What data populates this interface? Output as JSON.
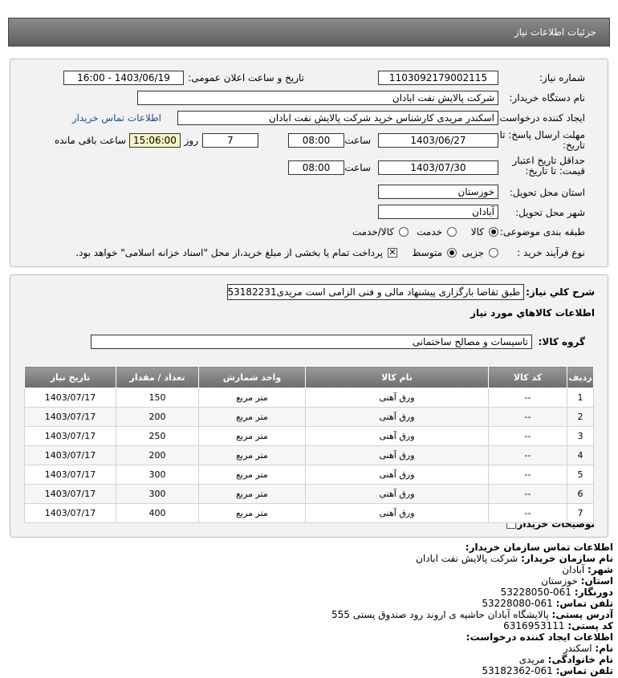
{
  "header": {
    "title": "جزئیات اطلاعات نیاز"
  },
  "fields": {
    "need_number_label": "شماره نیاز:",
    "need_number": "1103092179002115",
    "announce_label": "تاریخ و ساعت اعلان عمومی:",
    "announce_value": "1403/06/19 - 16:00",
    "buyer_org_label": "نام دستگاه خریدار:",
    "buyer_org": "شرکت پالایش نفت ابادان",
    "creator_label": "ایجاد کننده درخواست:",
    "creator": "اسکندر مریدی کارشناس خرید شرکت پالایش نفت ابادان",
    "contact_link": "اطلاعات تماس خریدار",
    "deadline_label": "مهلت ارسال پاسخ: تا تاریخ:",
    "deadline_date": "1403/06/27",
    "time_label": "ساعت",
    "deadline_time": "08:00",
    "days_value": "7",
    "days_label": "روز و",
    "remaining_time": "15:06:00",
    "remaining_label": "ساعت باقی مانده",
    "validity_label": "حداقل تاریخ اعتبار قیمت: تا تاریخ:",
    "validity_date": "1403/07/30",
    "validity_time": "08:00",
    "province_label": "استان محل تحویل:",
    "province": "خوزستان",
    "city_label": "شهر محل تحویل:",
    "city": "آبادان",
    "category_label": "طبقه بندی موضوعی:",
    "category_options": [
      "کالا",
      "خدمت",
      "کالا/خدمت"
    ],
    "process_label": "نوع فرآیند خرید :",
    "process_options": [
      "جزیی",
      "متوسط"
    ],
    "payment_note": "پرداخت تمام یا بخشی از مبلغ خرید،از محل \"اسناد خزانه اسلامی\" خواهد بود."
  },
  "summary": {
    "desc_label": "شرح کلي نياز:",
    "desc_value": "طبق تقاضا بارگزاری پیشنهاد مالی و فنی الزامی است مریدی53182231",
    "goods_title": "اطلاعات کالاهاي مورد نياز",
    "group_label": "گروه کالا:",
    "group_value": "تاسیسات و مصالح ساختمانی"
  },
  "table": {
    "headers": [
      "ردیف",
      "کد کالا",
      "نام کالا",
      "واحد شمارش",
      "تعداد / مقدار",
      "تاریخ نیاز"
    ],
    "rows": [
      [
        "1",
        "--",
        "ورق آهنی",
        "متر مربع",
        "150",
        "1403/07/17"
      ],
      [
        "2",
        "--",
        "ورق آهنی",
        "متر مربع",
        "200",
        "1403/07/17"
      ],
      [
        "3",
        "--",
        "ورق آهنی",
        "متر مربع",
        "250",
        "1403/07/17"
      ],
      [
        "4",
        "--",
        "ورق آهنی",
        "متر مربع",
        "200",
        "1403/07/17"
      ],
      [
        "5",
        "--",
        "ورق آهنی",
        "متر مربع",
        "300",
        "1403/07/17"
      ],
      [
        "6",
        "--",
        "ورق آهنی",
        "متر مربع",
        "300",
        "1403/07/17"
      ],
      [
        "7",
        "--",
        "ورق آهنی",
        "متر مربع",
        "400",
        "1403/07/17"
      ]
    ]
  },
  "buyer_notes_label": "توضیحات خریدار:",
  "contact": {
    "title": "اطلاعات تماس سازمان خریدار:",
    "org_label": "نام سازمان خریدار:",
    "org": "شرکت پالایش نفت ابادان",
    "city_label": "شهر:",
    "city": "آبادان",
    "province_label": "استان:",
    "province": "خوزستان",
    "fax_label": "دورنگار:",
    "fax": "061-53228050",
    "phone_label": "تلفن تماس:",
    "phone": "061-53228080",
    "address_label": "آدرس پستی:",
    "address": "پالایشگاه آبادان حاشیه ی اروند رود صندوق پستی 555",
    "postal_label": "کد پستی:",
    "postal": "6316953111",
    "creator_title": "اطلاعات ایجاد کننده درخواست:",
    "name_label": "نام:",
    "name": "اسکندر",
    "family_label": "نام خانوادگی:",
    "family": "مریدی",
    "creator_phone_label": "تلفن تماس:",
    "creator_phone": "061-53182362"
  }
}
